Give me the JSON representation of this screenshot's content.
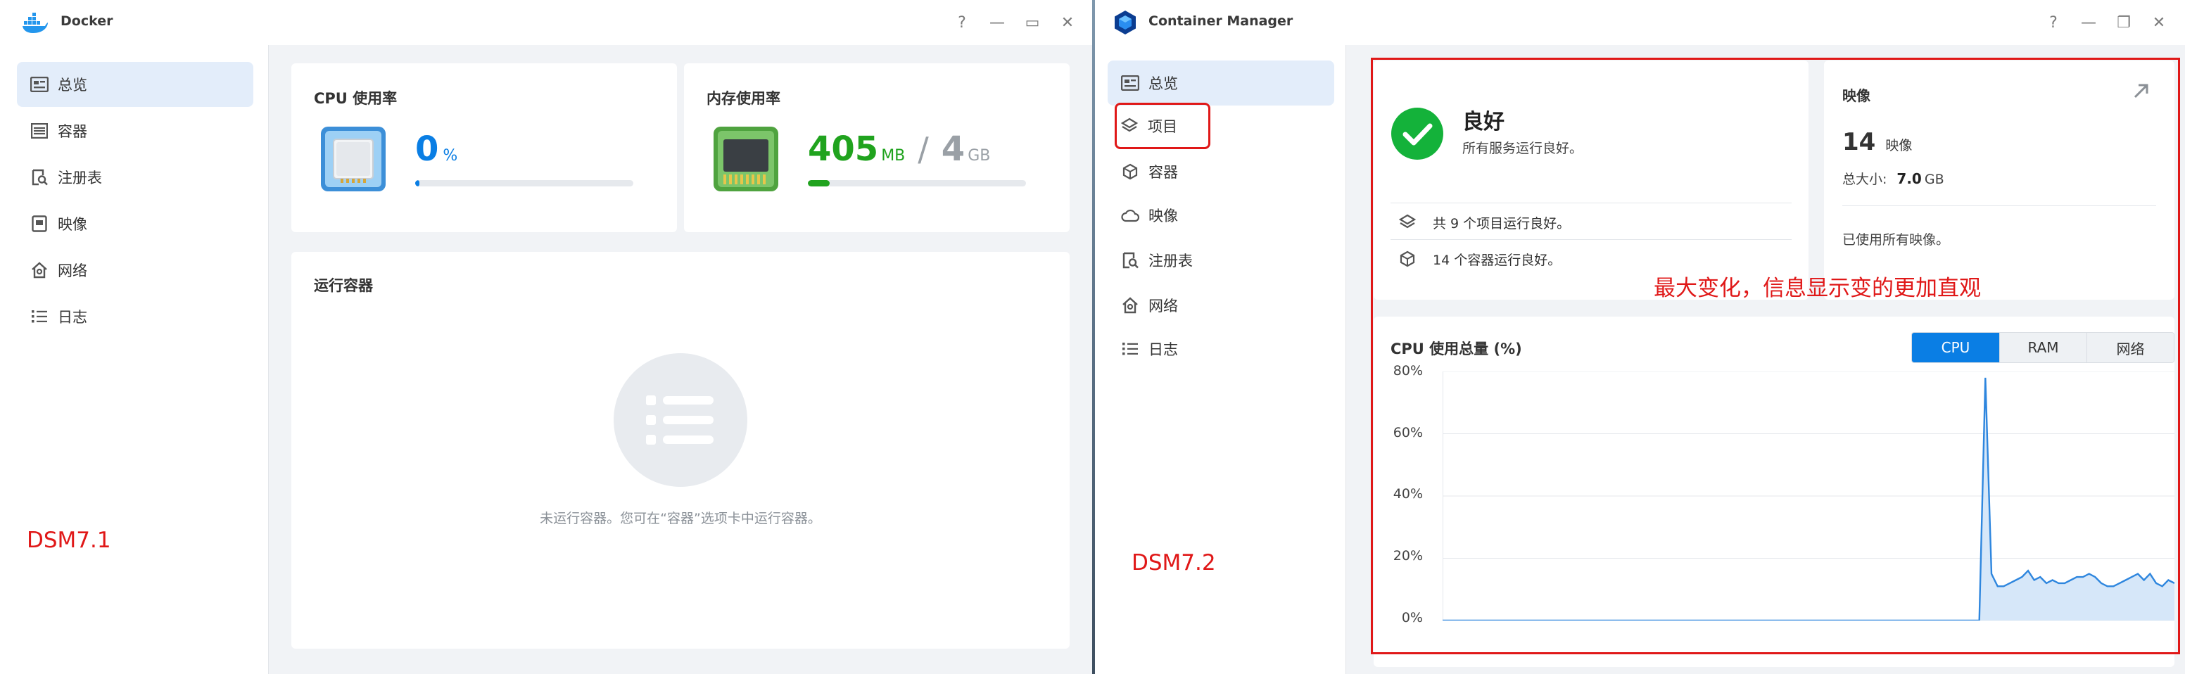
{
  "dsm71": {
    "app_title": "Docker",
    "window_controls": [
      "?",
      "—",
      "▭",
      "✕"
    ],
    "sidebar": [
      {
        "label": "总览",
        "icon": "overview-icon",
        "active": true
      },
      {
        "label": "容器",
        "icon": "container-list-icon"
      },
      {
        "label": "注册表",
        "icon": "registry-icon"
      },
      {
        "label": "映像",
        "icon": "image-icon"
      },
      {
        "label": "网络",
        "icon": "network-icon"
      },
      {
        "label": "日志",
        "icon": "log-icon"
      }
    ],
    "cpu_card": {
      "title": "CPU 使用率",
      "value": "0",
      "unit": "%",
      "percent": 2
    },
    "mem_card": {
      "title": "内存使用率",
      "used": "405",
      "used_unit": "MB",
      "separator": "/",
      "total": "4",
      "total_unit": "GB",
      "percent": 10
    },
    "running_card": {
      "title": "运行容器",
      "empty_text": "未运行容器。您可在“容器”选项卡中运行容器。"
    },
    "annotation": "DSM7.1"
  },
  "dsm72": {
    "app_title": "Container Manager",
    "window_controls": [
      "?",
      "—",
      "❐",
      "✕"
    ],
    "sidebar": [
      {
        "label": "总览",
        "icon": "overview-icon",
        "active": true
      },
      {
        "label": "项目",
        "icon": "project-layers-icon",
        "highlighted": true
      },
      {
        "label": "容器",
        "icon": "container-cube-icon"
      },
      {
        "label": "映像",
        "icon": "image-cloud-icon"
      },
      {
        "label": "注册表",
        "icon": "registry-icon"
      },
      {
        "label": "网络",
        "icon": "network-icon"
      },
      {
        "label": "日志",
        "icon": "log-icon"
      }
    ],
    "status": {
      "title": "良好",
      "subtitle": "所有服务运行良好。",
      "projects_text": "共 9 个项目运行良好。",
      "containers_text": "14 个容器运行良好。"
    },
    "images": {
      "title": "映像",
      "count": "14",
      "count_label": "映像",
      "size_label": "总大小:",
      "size_value": "7.0",
      "size_unit": "GB",
      "note": "已使用所有映像。"
    },
    "cpu_chart": {
      "title": "CPU 使用总量 (%)",
      "tabs": [
        "CPU",
        "RAM",
        "网络"
      ],
      "active_tab": "CPU"
    },
    "annotation_main": "最大变化，信息显示变的更加直观",
    "annotation_label": "DSM7.2"
  },
  "colors": {
    "accent": "#0a7ee4",
    "green_text": "#20a31e",
    "success": "#14b23a",
    "annotation": "#e01818"
  },
  "chart_data": {
    "type": "area",
    "title": "CPU 使用总量 (%)",
    "ylabel": "%",
    "ylim": [
      0,
      80
    ],
    "yticks": [
      "0%",
      "20%",
      "40%",
      "60%",
      "80%"
    ],
    "x": [
      0,
      88,
      89,
      90,
      91,
      92,
      93,
      94,
      95,
      96,
      97,
      98,
      99,
      100,
      101,
      102,
      103,
      104,
      105,
      106,
      107,
      108,
      109,
      110,
      111,
      112,
      113,
      114,
      115,
      116,
      117,
      118,
      119,
      120
    ],
    "values": [
      0,
      0,
      78,
      15,
      11,
      11,
      12,
      13,
      14,
      16,
      13,
      14,
      12,
      13,
      12,
      12,
      13,
      14,
      14,
      15,
      14,
      12,
      11,
      11,
      12,
      13,
      14,
      15,
      13,
      15,
      12,
      11,
      13,
      12
    ],
    "xlim": [
      0,
      120
    ]
  }
}
